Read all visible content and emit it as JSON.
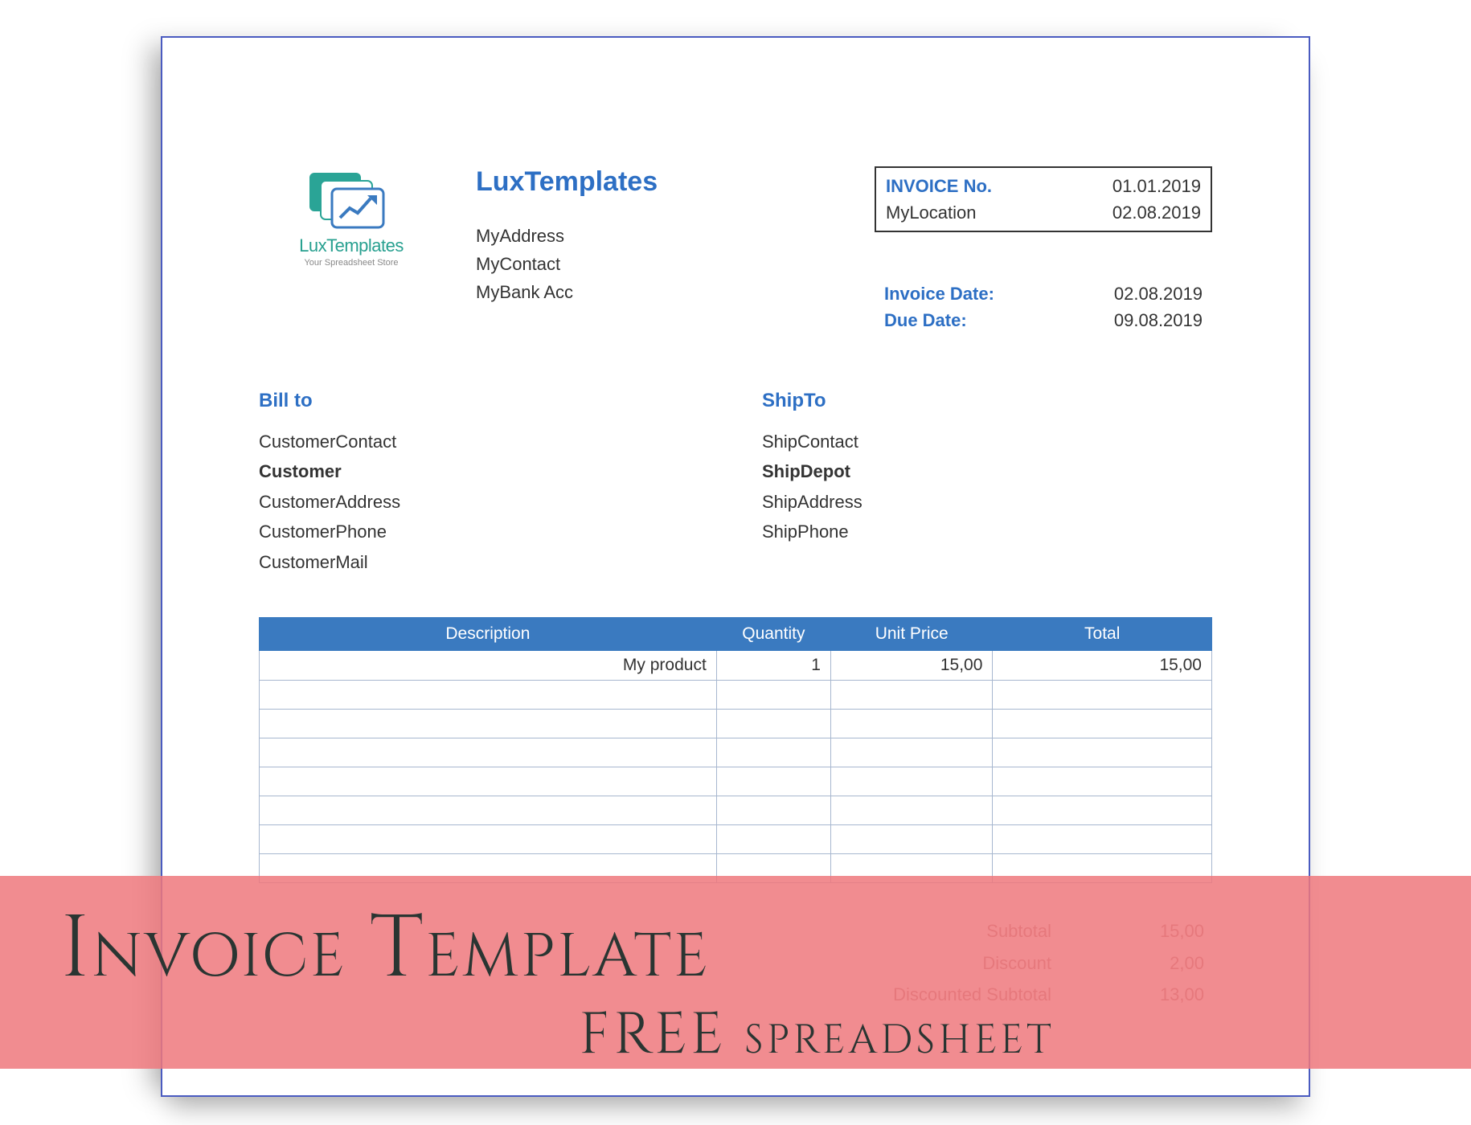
{
  "logo": {
    "brand": "LuxTemplates",
    "tagline": "Your Spreadsheet Store"
  },
  "company": {
    "name": "LuxTemplates",
    "address": "MyAddress",
    "contact": "MyContact",
    "bank": "MyBank Acc"
  },
  "meta": {
    "invoice_no_label": "INVOICE No.",
    "invoice_no_value": "01.01.2019",
    "location_label": "MyLocation",
    "location_value": "02.08.2019",
    "invoice_date_label": "Invoice Date:",
    "invoice_date_value": "02.08.2019",
    "due_date_label": "Due Date:",
    "due_date_value": "09.08.2019"
  },
  "bill_to": {
    "heading": "Bill to",
    "contact": "CustomerContact",
    "name": "Customer",
    "address": "CustomerAddress",
    "phone": "CustomerPhone",
    "mail": "CustomerMail"
  },
  "ship_to": {
    "heading": "ShipTo",
    "contact": "ShipContact",
    "name": "ShipDepot",
    "address": "ShipAddress",
    "phone": "ShipPhone"
  },
  "table": {
    "headers": {
      "description": "Description",
      "quantity": "Quantity",
      "unit_price": "Unit Price",
      "total": "Total"
    },
    "rows": [
      {
        "description": "My product",
        "quantity": "1",
        "unit_price": "15,00",
        "total": "15,00"
      },
      {
        "description": "",
        "quantity": "",
        "unit_price": "",
        "total": ""
      },
      {
        "description": "",
        "quantity": "",
        "unit_price": "",
        "total": ""
      },
      {
        "description": "",
        "quantity": "",
        "unit_price": "",
        "total": ""
      },
      {
        "description": "",
        "quantity": "",
        "unit_price": "",
        "total": ""
      },
      {
        "description": "",
        "quantity": "",
        "unit_price": "",
        "total": ""
      },
      {
        "description": "",
        "quantity": "",
        "unit_price": "",
        "total": ""
      },
      {
        "description": "",
        "quantity": "",
        "unit_price": "",
        "total": ""
      }
    ]
  },
  "totals": {
    "subtotal_label": "Subtotal",
    "subtotal_value": "15,00",
    "discount_label": "Discount",
    "discount_value": "2,00",
    "discounted_label": "Discounted Subtotal",
    "discounted_value": "13,00"
  },
  "banner": {
    "title": "Invoice Template",
    "subtitle": "FREE spreadsheet"
  }
}
